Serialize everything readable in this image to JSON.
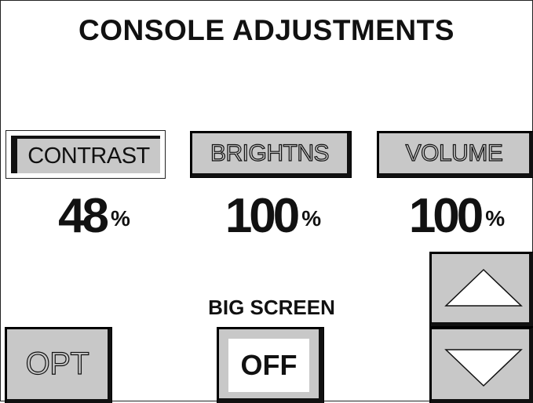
{
  "title": "CONSOLE ADJUSTMENTS",
  "controls": [
    {
      "label": "CONTRAST",
      "value": "48",
      "unit": "%",
      "selected": true
    },
    {
      "label": "BRIGHTNS",
      "value": "100",
      "unit": "%",
      "selected": false
    },
    {
      "label": "VOLUME",
      "value": "100",
      "unit": "%",
      "selected": false
    }
  ],
  "big_screen": {
    "caption": "BIG SCREEN",
    "state": "OFF"
  },
  "opt_label": "OPT",
  "icons": {
    "up": "triangle-up-icon",
    "down": "triangle-down-icon"
  },
  "colors": {
    "button_gray": "#c8c8c8",
    "text": "#111111",
    "background": "#ffffff"
  }
}
